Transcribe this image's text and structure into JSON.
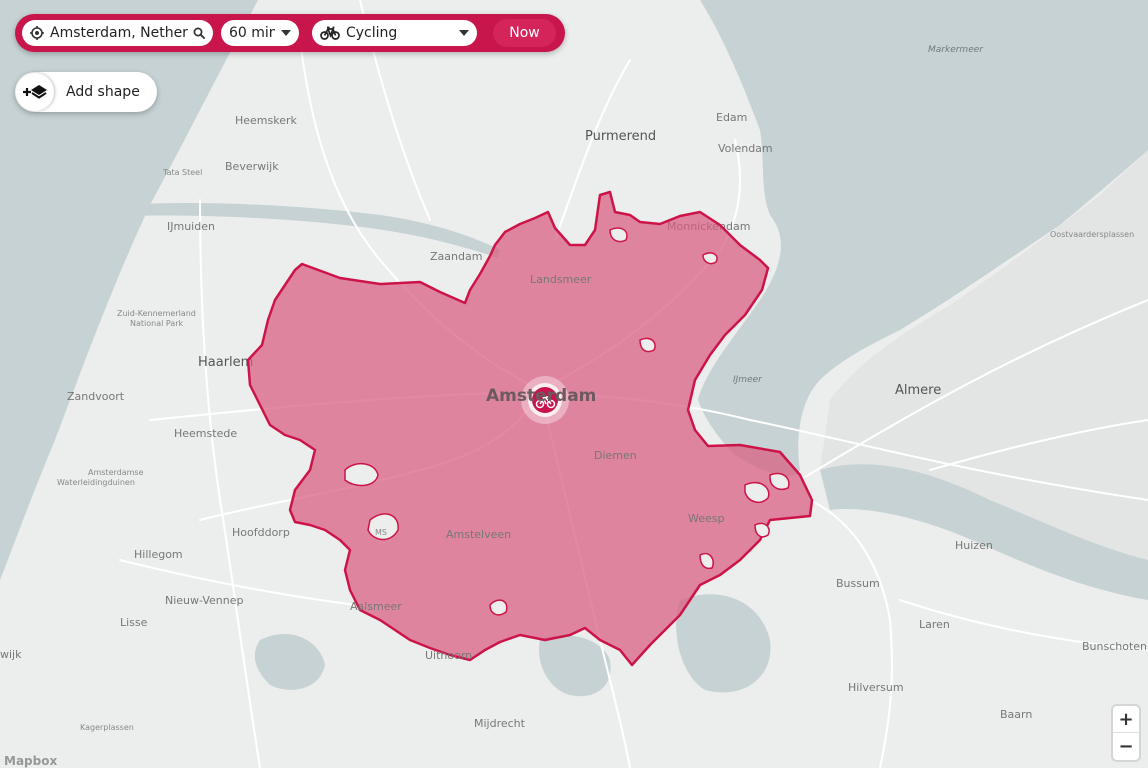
{
  "controls": {
    "location_value": "Amsterdam, Netherlands",
    "duration_value": "60 min",
    "mode_value": "Cycling",
    "now_label": "Now",
    "add_shape_label": "Add shape",
    "zoom_in": "+",
    "zoom_out": "−",
    "icons": {
      "location": "crosshair-icon",
      "search": "search-icon",
      "mode": "bicycle-icon",
      "add_shape": "add-layer-icon",
      "center_marker": "bicycle-marker-icon"
    }
  },
  "map": {
    "attribution": "Mapbox",
    "colors": {
      "land": "#eceeed",
      "water": "#c6d2d4",
      "isochrone_fill": "#d95c80",
      "isochrone_stroke": "#cc1448",
      "accent": "#c8154c"
    },
    "labels": {
      "markermeer": "Markermeer",
      "heemskerk": "Heemskerk",
      "edam": "Edam",
      "purmerend": "Purmerend",
      "volendam": "Volendam",
      "tata_steel": "Tata Steel",
      "beverwijk": "Beverwijk",
      "ijmuiden": "IJmuiden",
      "zaandam": "Zaandam",
      "monnickendam": "Monnickendam",
      "oostvaardersplassen": "Oostvaardersplassen",
      "landsmeer": "Landsmeer",
      "zuid_kennemerland_1": "Zuid-Kennemerland",
      "zuid_kennemerland_2": "National Park",
      "haarlem": "Haarlem",
      "amsterdam": "Amsterdam",
      "ijmeer": "IJmeer",
      "almere": "Almere",
      "zandvoort": "Zandvoort",
      "heemstede": "Heemstede",
      "diemen": "Diemen",
      "amsterdamse_1": "Amsterdamse",
      "amsterdamse_2": "Waterleidingduinen",
      "hoofddorp": "Hoofddorp",
      "amstelveen": "Amstelveen",
      "weesp": "Weesp",
      "huizen": "Huizen",
      "hillegom": "Hillegom",
      "bussum": "Bussum",
      "nieuw_vennep": "Nieuw-Vennep",
      "aalsmeer": "Aalsmeer",
      "lisse": "Lisse",
      "laren": "Laren",
      "bunschoten": "Bunschoten",
      "uithoorn": "Uithoorn",
      "wijk": "wijk",
      "hilversum": "Hilversum",
      "mijdrecht": "Mijdrecht",
      "baarn": "Baarn",
      "kagerplassen": "Kagerplassen",
      "ms": "MS"
    }
  }
}
